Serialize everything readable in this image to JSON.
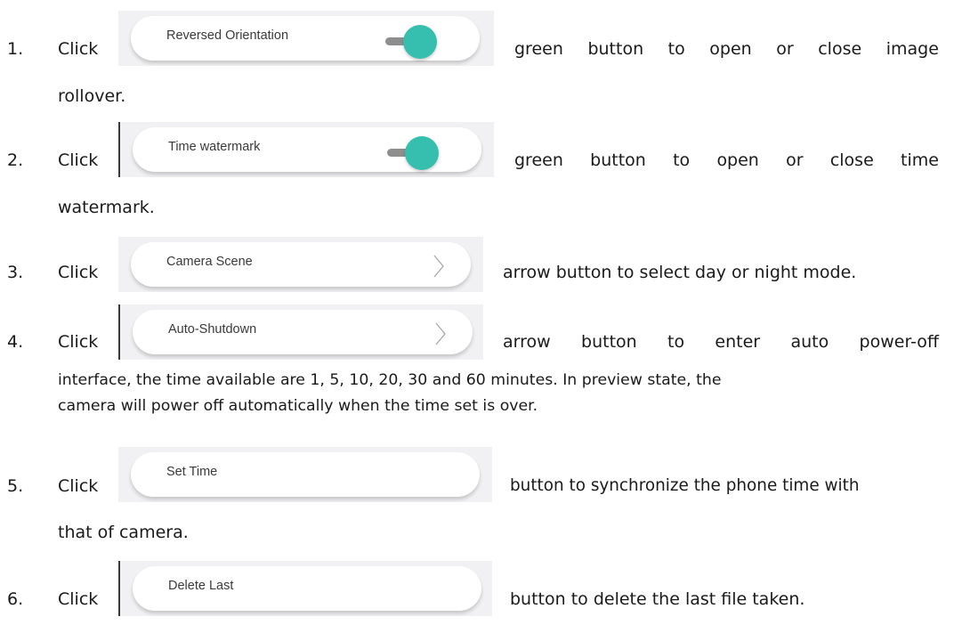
{
  "click_word": "Click",
  "steps": [
    {
      "number": "1.",
      "button_label": "Reversed Orientation",
      "control": "toggle-on",
      "desc_words": [
        "green",
        "button",
        "to",
        "open",
        "or",
        "close",
        "image"
      ],
      "desc_cont": "rollover."
    },
    {
      "number": "2.",
      "button_label": "Time watermark",
      "control": "toggle-on",
      "desc_words": [
        "green",
        "button",
        "to",
        "open",
        "or",
        "close",
        "time"
      ],
      "desc_cont": "watermark."
    },
    {
      "number": "3.",
      "button_label": "Camera Scene",
      "control": "chevron-right-icon",
      "desc": "arrow button to select day or night mode."
    },
    {
      "number": "4.",
      "button_label": "Auto-Shutdown",
      "control": "chevron-right-icon",
      "desc_words": [
        "arrow",
        "button",
        "to",
        "enter",
        "auto",
        "power-off"
      ],
      "desc_cont_lines": [
        "interface, the time available are 1, 5, 10, 20, 30 and 60 minutes. In preview state, the",
        "camera will power off automatically when the time set is over."
      ]
    },
    {
      "number": "5.",
      "button_label": "Set Time",
      "desc": "button to synchronize the phone time with",
      "desc_cont": "that of camera."
    },
    {
      "number": "6.",
      "button_label": "Delete Last",
      "desc": "button to delete the last file taken."
    }
  ],
  "colors": {
    "toggle_on": "#36bfae",
    "toggle_track": "#8e8e8e",
    "pill_bg": "#f1f1f3"
  }
}
